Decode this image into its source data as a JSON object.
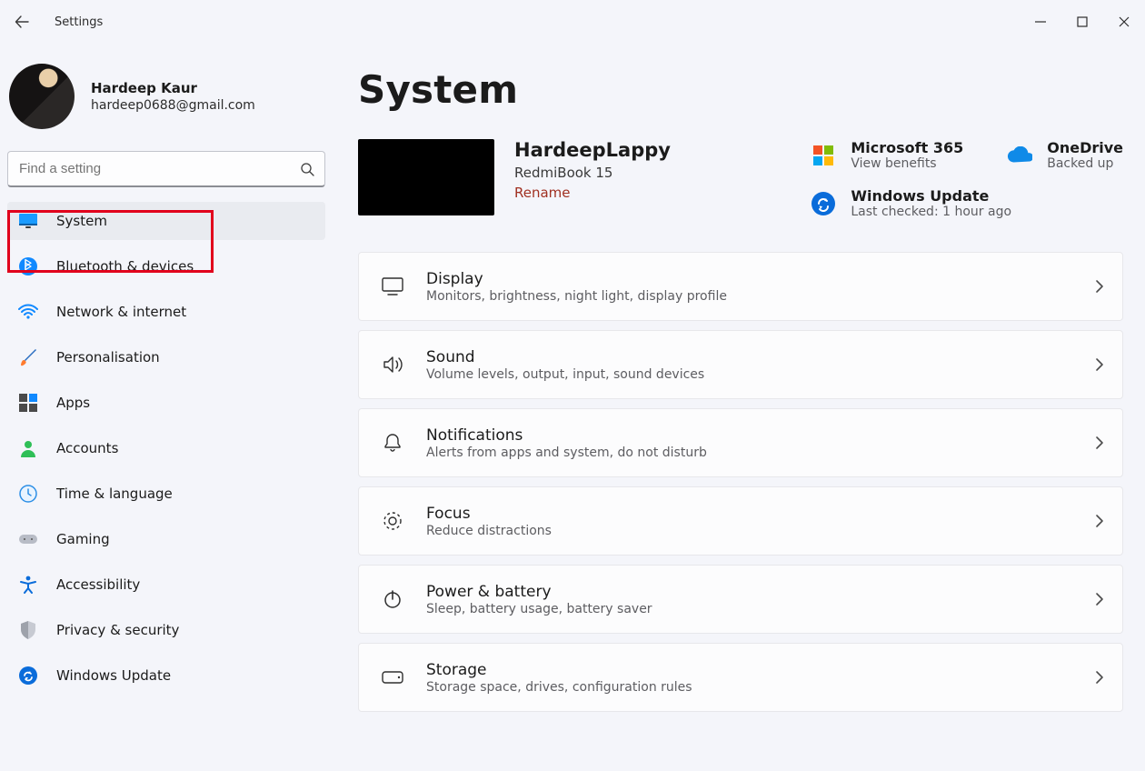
{
  "titlebar": {
    "title": "Settings"
  },
  "profile": {
    "name": "Hardeep Kaur",
    "email": "hardeep0688@gmail.com"
  },
  "search": {
    "placeholder": "Find a setting"
  },
  "nav": {
    "items": [
      {
        "label": "System",
        "active": true
      },
      {
        "label": "Bluetooth & devices",
        "active": false
      },
      {
        "label": "Network & internet",
        "active": false
      },
      {
        "label": "Personalisation",
        "active": false
      },
      {
        "label": "Apps",
        "active": false
      },
      {
        "label": "Accounts",
        "active": false
      },
      {
        "label": "Time & language",
        "active": false
      },
      {
        "label": "Gaming",
        "active": false
      },
      {
        "label": "Accessibility",
        "active": false
      },
      {
        "label": "Privacy & security",
        "active": false
      },
      {
        "label": "Windows Update",
        "active": false
      }
    ]
  },
  "page": {
    "title": "System"
  },
  "device": {
    "name": "HardeepLappy",
    "model": "RedmiBook 15",
    "rename": "Rename"
  },
  "tiles": {
    "m365": {
      "title": "Microsoft 365",
      "sub": "View benefits"
    },
    "onedrive": {
      "title": "OneDrive",
      "sub": "Backed up"
    },
    "winupdate": {
      "title": "Windows Update",
      "sub": "Last checked: 1 hour ago"
    }
  },
  "cards": [
    {
      "title": "Display",
      "sub": "Monitors, brightness, night light, display profile"
    },
    {
      "title": "Sound",
      "sub": "Volume levels, output, input, sound devices"
    },
    {
      "title": "Notifications",
      "sub": "Alerts from apps and system, do not disturb"
    },
    {
      "title": "Focus",
      "sub": "Reduce distractions"
    },
    {
      "title": "Power & battery",
      "sub": "Sleep, battery usage, battery saver"
    },
    {
      "title": "Storage",
      "sub": "Storage space, drives, configuration rules"
    }
  ]
}
